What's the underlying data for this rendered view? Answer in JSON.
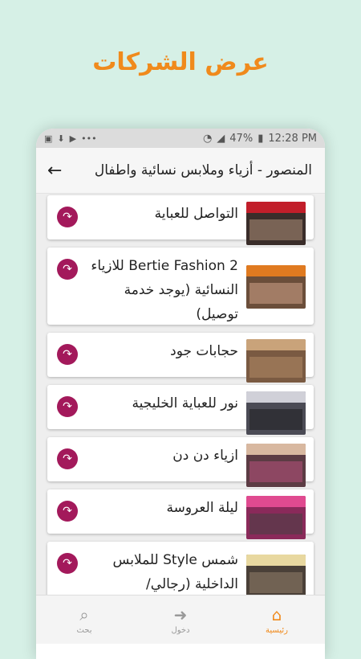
{
  "promo": {
    "title": "عرض الشركات"
  },
  "status_bar": {
    "battery": "47%",
    "time": "12:28 PM"
  },
  "app_bar": {
    "title": "المنصور - أزياء وملابس نسائية واطفال"
  },
  "colors": {
    "accent": "#a3195b",
    "promo": "#f08a1c",
    "background": "#d6f0e6"
  },
  "shops": [
    {
      "name": "التواصل للعباية",
      "thumb": "#3a2d2a"
    },
    {
      "name": "Bertie Fashion 2 للازياء النسائية (يوجد خدمة توصيل)",
      "thumb": "#6b4e3a"
    },
    {
      "name": "حجابات جود",
      "thumb": "#7a5a42"
    },
    {
      "name": "نور للعباية الخليجية",
      "thumb": "#4b4b55"
    },
    {
      "name": "ازياء دن دن",
      "thumb": "#5c3c44"
    },
    {
      "name": "ليلة العروسة",
      "thumb": "#8a2a5a"
    },
    {
      "name": "شمس Style للملابس الداخلية (رجالي/",
      "thumb": "#4a4038"
    }
  ],
  "bottom_nav": {
    "search": "بحث",
    "login": "دخول",
    "home": "رئيسية"
  }
}
